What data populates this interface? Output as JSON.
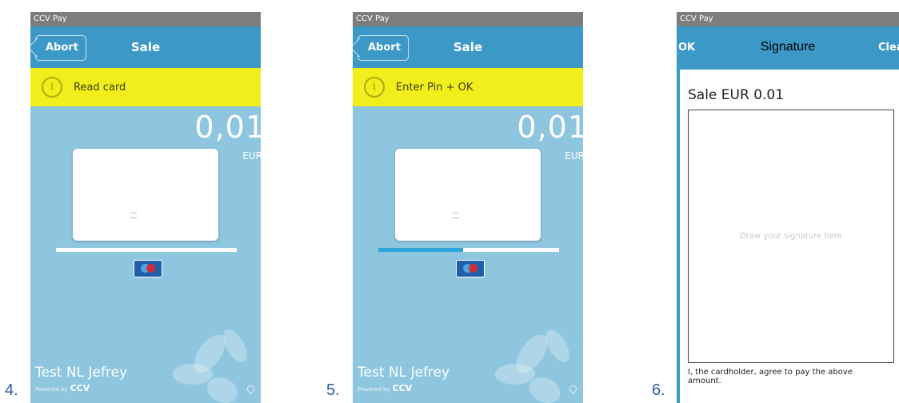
{
  "steps": [
    "4.",
    "5.",
    "6."
  ],
  "screens": [
    {
      "status_title": "CCV Pay",
      "abort_label": "Abort",
      "title": "Sale",
      "notice": "Read card",
      "notice_icon": "info-icon",
      "amount": "0,01",
      "currency": "EUR",
      "card_chip": "chip-icon",
      "progress": 0.0,
      "brand_logo": "maestro-icon",
      "merchant": "Test NL Jefrey",
      "powered_by": "Powered by",
      "powered_brand": "CCV",
      "colors": {
        "accent": "#3c98c6",
        "notice": "#f2ee1c",
        "background": "#8fc6df",
        "progress": "#2fa3dc"
      }
    },
    {
      "status_title": "CCV Pay",
      "abort_label": "Abort",
      "title": "Sale",
      "notice": "Enter Pin + OK",
      "notice_icon": "info-icon",
      "amount": "0,01",
      "currency": "EUR",
      "card_chip": "chip-icon",
      "progress": 0.47,
      "brand_logo": "maestro-icon",
      "merchant": "Test NL Jefrey",
      "powered_by": "Powered by",
      "powered_brand": "CCV",
      "colors": {
        "accent": "#3c98c6",
        "notice": "#f2ee1c",
        "background": "#8fc6df",
        "progress": "#2fa3dc"
      }
    },
    {
      "status_title": "CCV Pay",
      "ok_label": "OK",
      "title": "Signature",
      "clear_label": "Clear",
      "heading": "Sale EUR 0.01",
      "placeholder": "Draw your signature here",
      "agreement": "I, the cardholder, agree to pay the above amount."
    }
  ]
}
